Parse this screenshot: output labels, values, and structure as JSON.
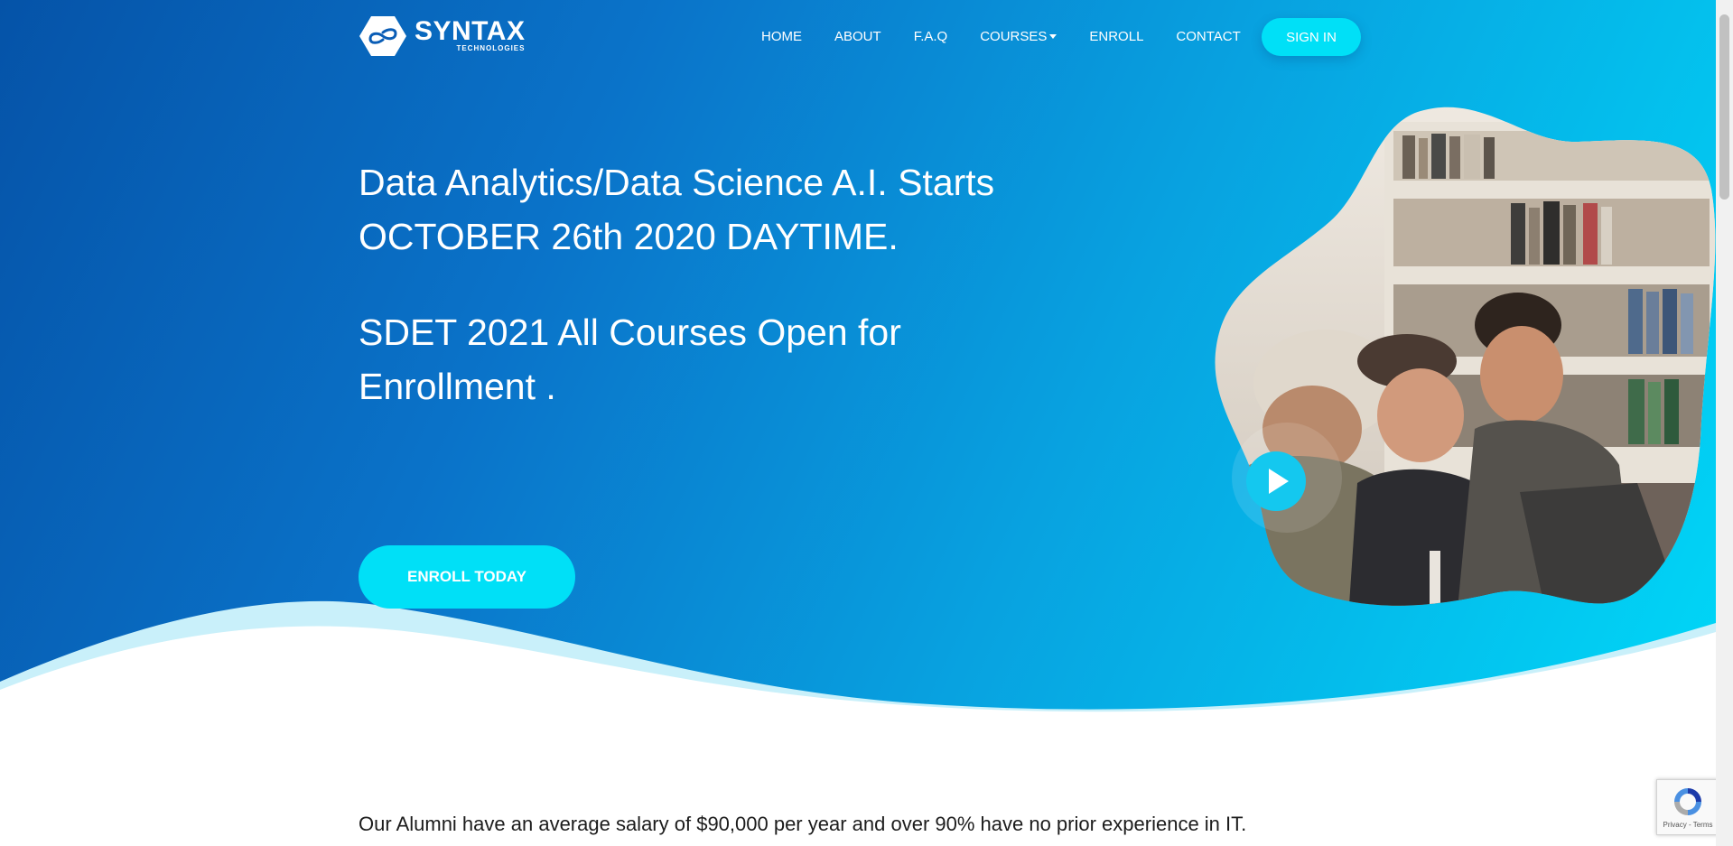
{
  "brand": {
    "name": "SYNTAX",
    "subtitle": "TECHNOLOGIES"
  },
  "nav": {
    "home": "HOME",
    "about": "ABOUT",
    "faq": "F.A.Q",
    "courses": "COURSES",
    "enroll": "ENROLL",
    "contact": "CONTACT",
    "signin": "SIGN IN"
  },
  "hero": {
    "headline1": "Data Analytics/Data Science A.I. Starts OCTOBER 26th 2020 DAYTIME.",
    "headline2": "SDET 2021 All Courses Open for Enrollment .",
    "cta": "ENROLL TODAY"
  },
  "alumni": "Our Alumni have an average salary of $90,000 per year and over 90% have no prior experience in IT.",
  "recaptcha": {
    "links": "Privacy - Terms"
  },
  "icons": {
    "logo": "syntax-logo-icon",
    "play": "play-icon",
    "recaptcha": "recaptcha-icon",
    "dropdown": "chevron-down-icon"
  },
  "colors": {
    "accent": "#00e0f7",
    "hero_start": "#0553a8",
    "hero_end": "#00d7f7"
  }
}
